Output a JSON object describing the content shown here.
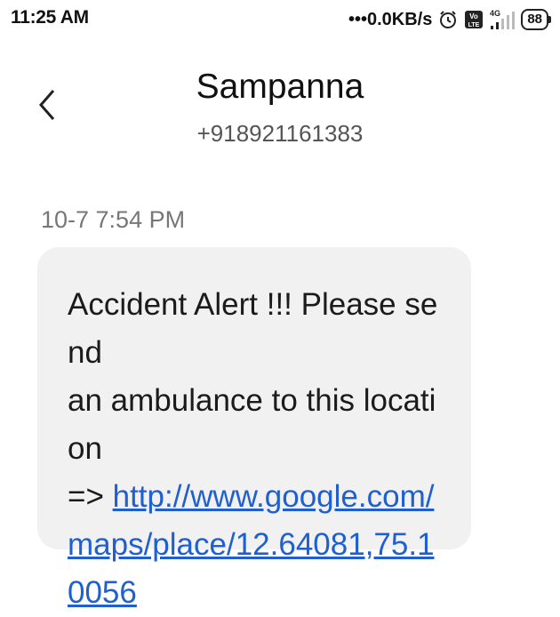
{
  "status_bar": {
    "time": "11:25 AM",
    "net_speed": "•••0.0KB/s",
    "battery": "88",
    "icons": [
      "alarm-icon",
      "volte-icon",
      "signal-4g-icon",
      "battery-icon"
    ]
  },
  "header": {
    "contact_name": "Sampanna",
    "contact_number": "+918921161383"
  },
  "message": {
    "timestamp": "10-7 7:54 PM",
    "text_line1": "Accident Alert !!! Please send",
    "text_line2": "an ambulance to this location",
    "text_prefix": "=> ",
    "link": "http://www.google.com/maps/place/12.64081,75.10056"
  },
  "colors": {
    "link": "#1f5fcf",
    "bubble": "#f1f1f1"
  }
}
